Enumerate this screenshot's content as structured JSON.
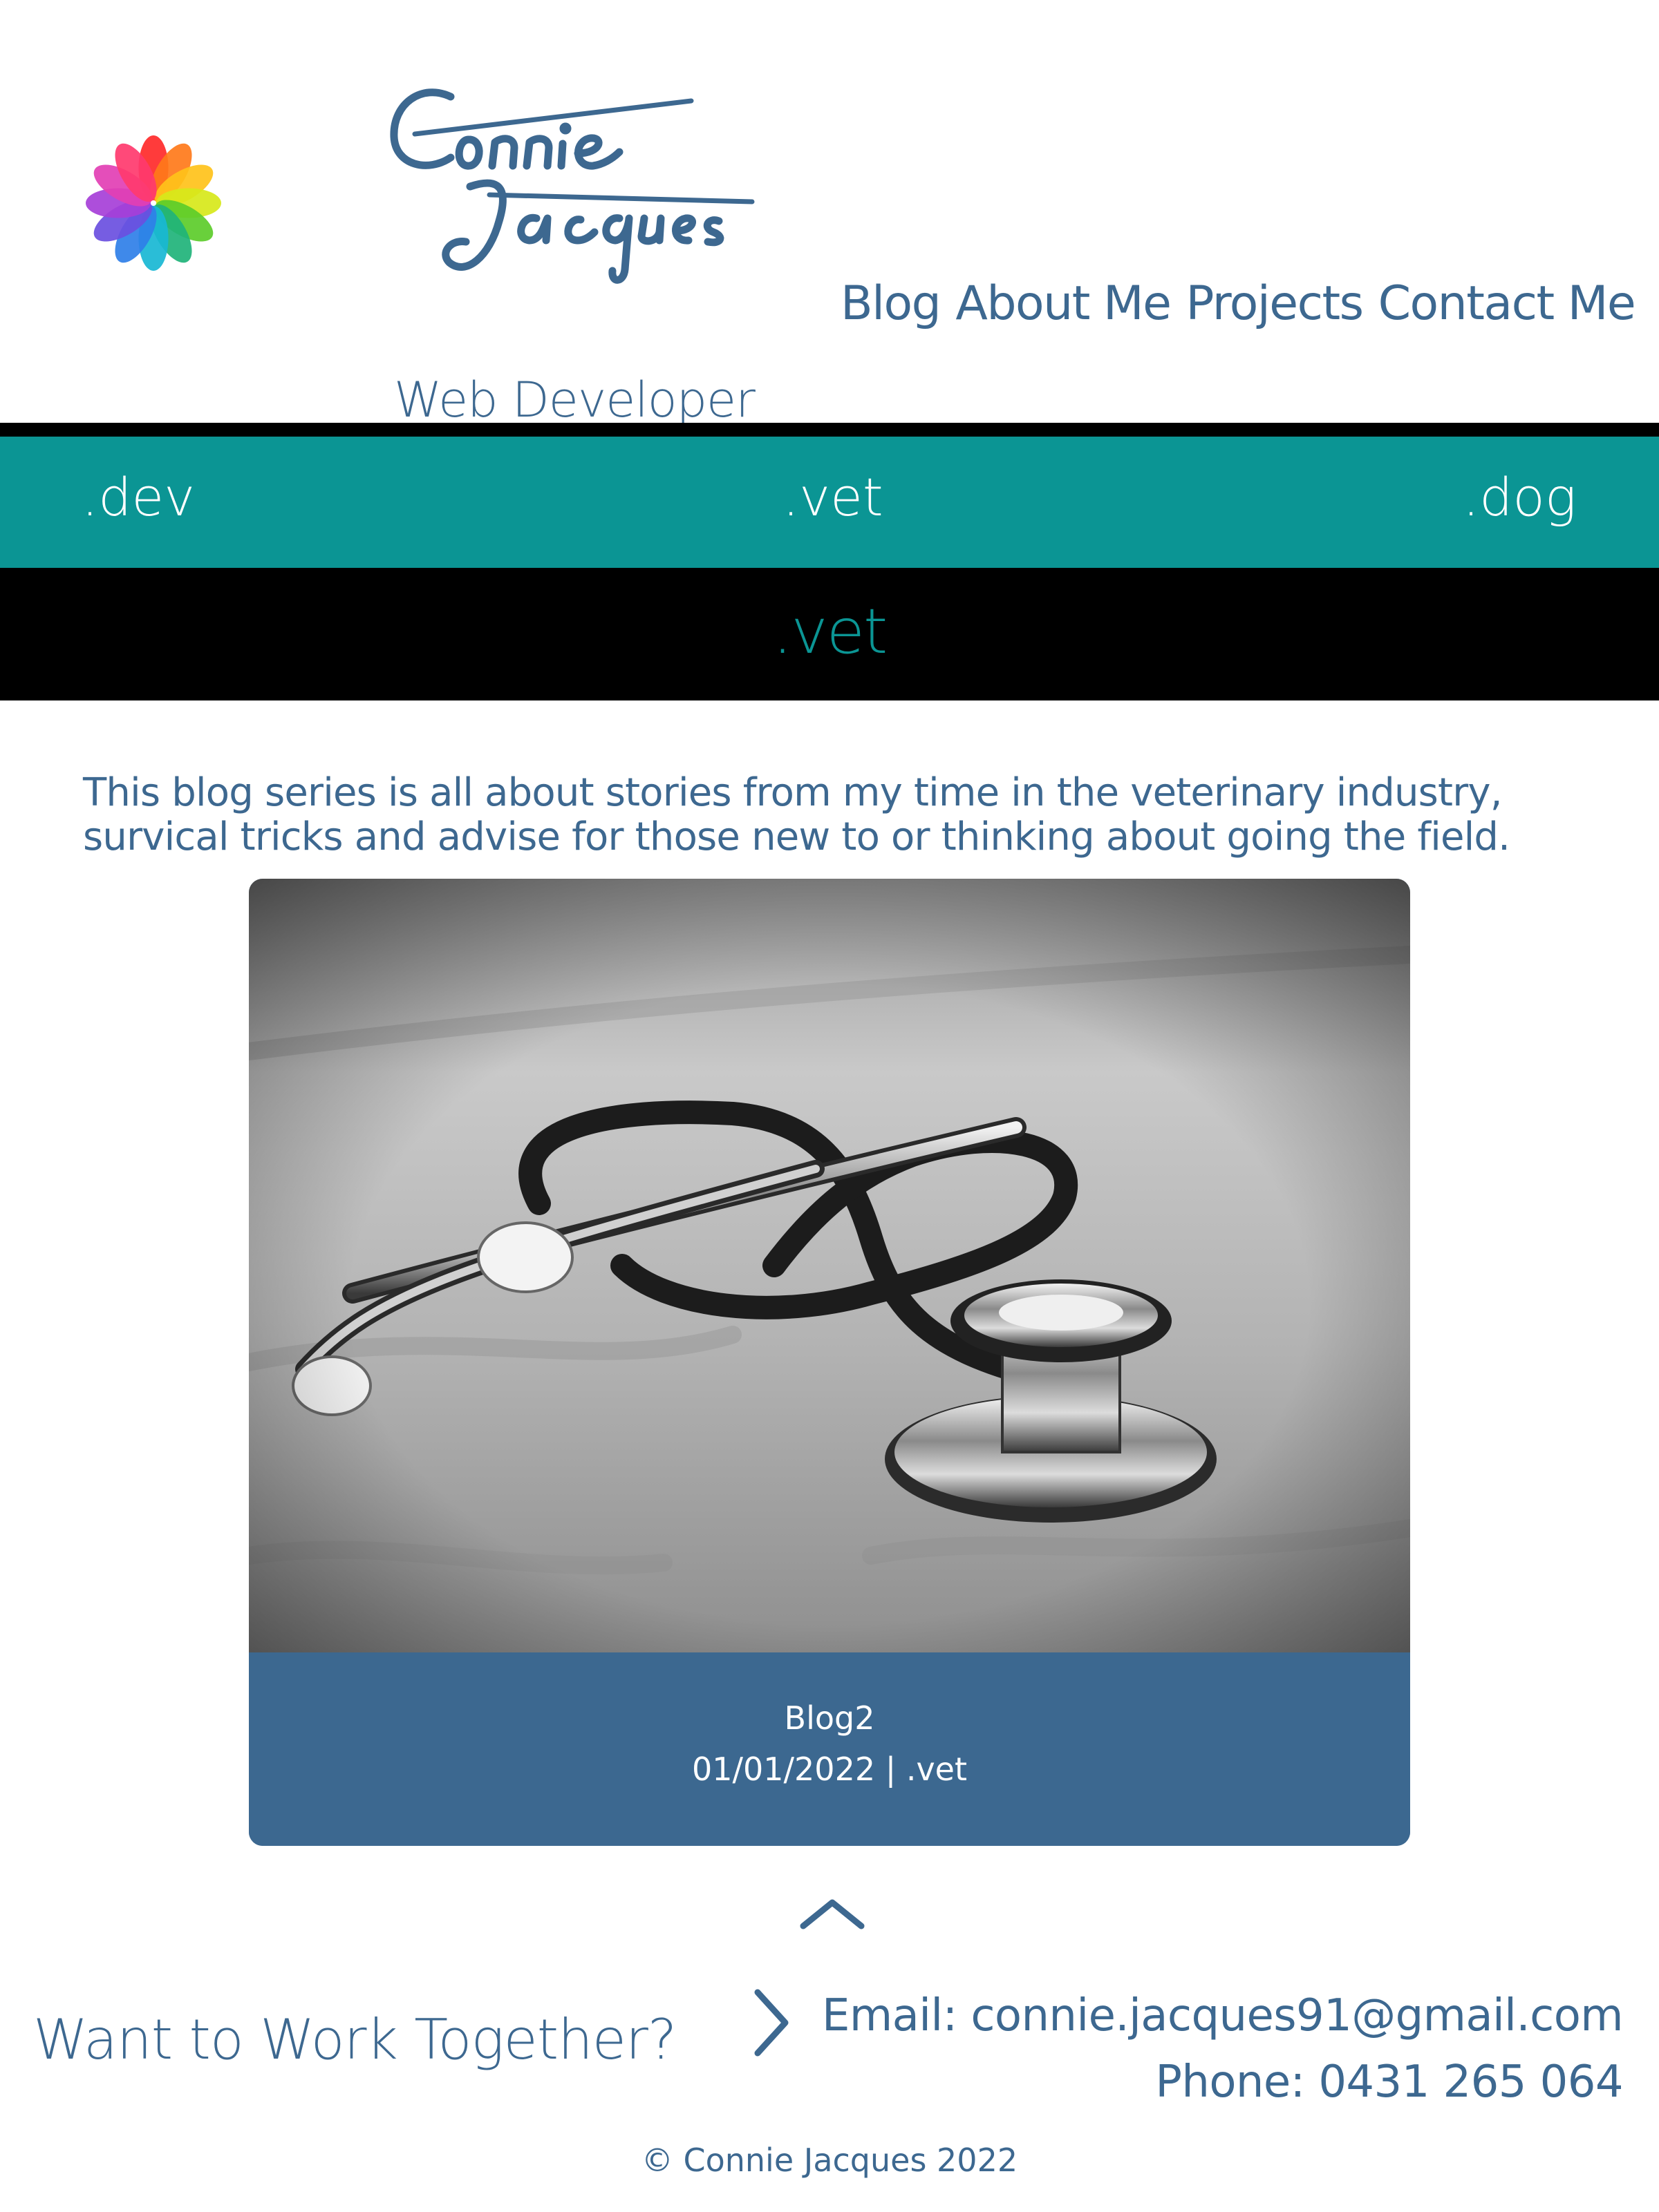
{
  "header": {
    "brand_name_line1": "Connie",
    "brand_name_line2": "Jacques",
    "subtitle": "Web Developer",
    "nav": [
      "Blog",
      "About Me",
      "Projects",
      "Contact Me"
    ]
  },
  "categories": {
    "items": [
      ".dev",
      ".vet",
      ".dog"
    ],
    "active": ".vet"
  },
  "intro": "This blog series is all about stories from my time in the veterinary industry, survical tricks and advise for those new to or thinking about going the field.",
  "blog_card": {
    "title": "Blog2",
    "meta": "01/01/2022 | .vet",
    "image_icon": "stethoscope-photo"
  },
  "back_to_top_icon": "chevron-up-icon",
  "footer": {
    "cta": "Want to Work Together?",
    "cta_icon": "chevron-right-icon",
    "email": "Email: connie.jacques91@gmail.com",
    "phone": "Phone: 0431 265 064",
    "copyright": "© Connie Jacques 2022"
  },
  "colors": {
    "primary_blue": "#3d6890",
    "teal": "#0b9594",
    "black": "#000000",
    "white": "#ffffff"
  }
}
